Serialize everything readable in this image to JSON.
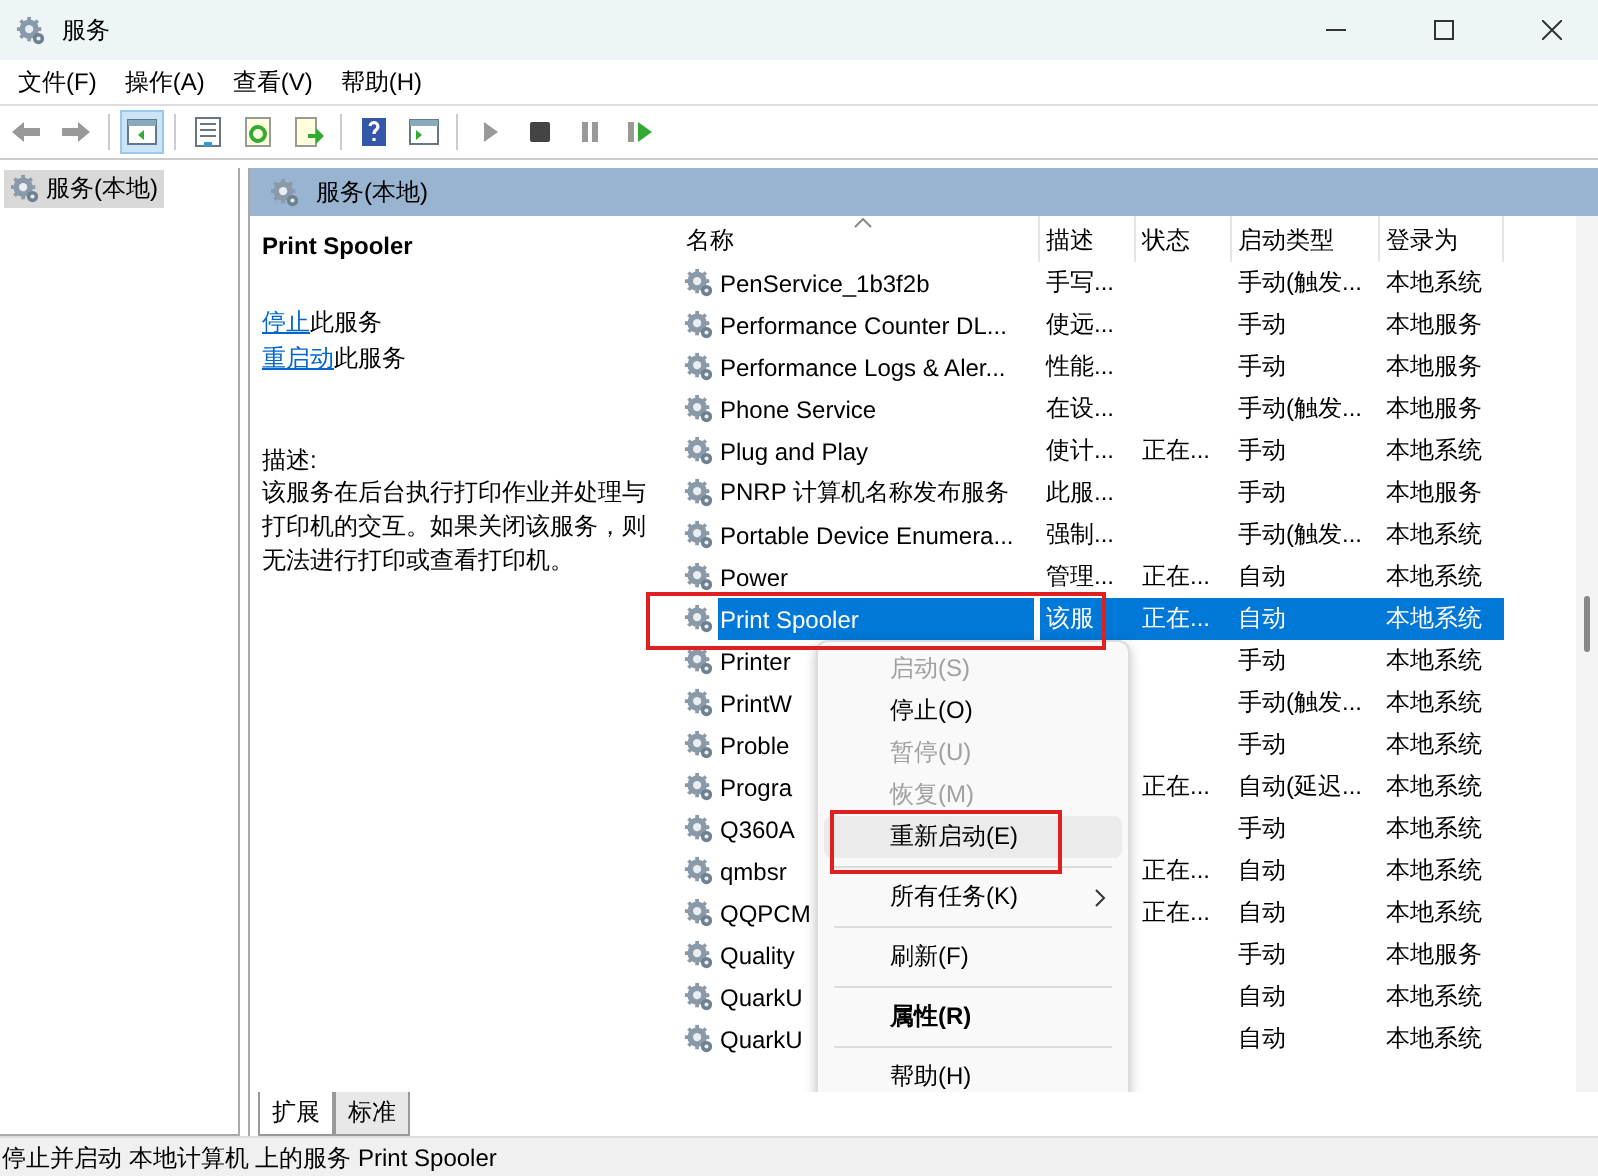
{
  "window": {
    "title": "服务"
  },
  "menu": [
    "文件(F)",
    "操作(A)",
    "查看(V)",
    "帮助(H)"
  ],
  "tree": {
    "items": [
      {
        "label": "服务(本地)",
        "selected": true
      }
    ]
  },
  "pane_header": "服务(本地)",
  "details": {
    "title": "Print Spooler",
    "actions": [
      {
        "link": "停止",
        "text": "此服务"
      },
      {
        "link": "重启动",
        "text": "此服务"
      }
    ],
    "description_label": "描述:",
    "description": "该服务在后台执行打印作业并处理与打印机的交互。如果关闭该服务，则无法进行打印或查看打印机。"
  },
  "table": {
    "columns": [
      "名称",
      "描述",
      "状态",
      "启动类型",
      "登录为"
    ],
    "rows": [
      {
        "name": "PenService_1b3f2b",
        "desc": "手写...",
        "startup": "手动(触发...",
        "logon": "本地系统",
        "selected": false
      },
      {
        "name": "Performance Counter DL...",
        "desc": "使远...",
        "startup": "手动",
        "logon": "本地服务",
        "selected": false
      },
      {
        "name": "Performance Logs & Aler...",
        "desc": "性能...",
        "startup": "手动",
        "logon": "本地服务",
        "selected": false
      },
      {
        "name": "Phone Service",
        "desc": "在设...",
        "startup": "手动(触发...",
        "logon": "本地服务",
        "selected": false
      },
      {
        "name": "Plug and Play",
        "desc": "使计...",
        "status": "正在...",
        "startup": "手动",
        "logon": "本地系统",
        "selected": false
      },
      {
        "name": "PNRP 计算机名称发布服务",
        "desc": "此服...",
        "startup": "手动",
        "logon": "本地服务",
        "selected": false
      },
      {
        "name": "Portable Device Enumera...",
        "desc": "强制...",
        "startup": "手动(触发...",
        "logon": "本地系统",
        "selected": false
      },
      {
        "name": "Power",
        "desc": "管理...",
        "status": "正在...",
        "startup": "自动",
        "logon": "本地系统",
        "selected": false
      },
      {
        "name": "Print Spooler",
        "desc": "该服",
        "status": "正在...",
        "startup": "自动",
        "logon": "本地系统",
        "selected": true
      },
      {
        "name": "Printer",
        "startup": "手动",
        "logon": "本地系统",
        "selected": false
      },
      {
        "name": "PrintW",
        "startup": "手动(触发...",
        "logon": "本地系统",
        "selected": false
      },
      {
        "name": "Proble",
        "startup": "手动",
        "logon": "本地系统",
        "selected": false
      },
      {
        "name": "Progra",
        "status": "正在...",
        "startup": "自动(延迟...",
        "logon": "本地系统",
        "selected": false
      },
      {
        "name": "Q360A",
        "startup": "手动",
        "logon": "本地系统",
        "selected": false
      },
      {
        "name": "qmbsr",
        "status": "正在...",
        "startup": "自动",
        "logon": "本地系统",
        "selected": false
      },
      {
        "name": "QQPCM",
        "status": "正在...",
        "startup": "自动",
        "logon": "本地系统",
        "selected": false
      },
      {
        "name": "Quality",
        "startup": "手动",
        "logon": "本地服务",
        "selected": false
      },
      {
        "name": "QuarkU",
        "startup": "自动",
        "logon": "本地系统",
        "selected": false
      },
      {
        "name": "QuarkU",
        "startup": "自动",
        "logon": "本地系统",
        "selected": false
      }
    ]
  },
  "context_menu": {
    "items": [
      {
        "kind": "item",
        "label": "启动(S)",
        "disabled": true,
        "hovered": false,
        "bold": false,
        "submenu": false
      },
      {
        "kind": "item",
        "label": "停止(O)",
        "disabled": false,
        "hovered": false,
        "bold": false,
        "submenu": false
      },
      {
        "kind": "item",
        "label": "暂停(U)",
        "disabled": true,
        "hovered": false,
        "bold": false,
        "submenu": false
      },
      {
        "kind": "item",
        "label": "恢复(M)",
        "disabled": true,
        "hovered": false,
        "bold": false,
        "submenu": false
      },
      {
        "kind": "item",
        "label": "重新启动(E)",
        "disabled": false,
        "hovered": true,
        "bold": false,
        "submenu": false
      },
      {
        "kind": "separator"
      },
      {
        "kind": "item",
        "label": "所有任务(K)",
        "disabled": false,
        "hovered": false,
        "bold": false,
        "submenu": true
      },
      {
        "kind": "separator"
      },
      {
        "kind": "item",
        "label": "刷新(F)",
        "disabled": false,
        "hovered": false,
        "bold": false,
        "submenu": false
      },
      {
        "kind": "separator"
      },
      {
        "kind": "item",
        "label": "属性(R)",
        "disabled": false,
        "hovered": false,
        "bold": true,
        "submenu": false
      },
      {
        "kind": "separator"
      },
      {
        "kind": "item",
        "label": "帮助(H)",
        "disabled": false,
        "hovered": false,
        "bold": false,
        "submenu": false
      }
    ]
  },
  "highlight_frames": {
    "selected_row": true,
    "hovered_menu_item": true
  },
  "tabs": [
    {
      "label": "扩展",
      "selected": true
    },
    {
      "label": "标准",
      "selected": false
    }
  ],
  "status_bar": "停止并启动 本地计算机 上的服务 Print Spooler"
}
